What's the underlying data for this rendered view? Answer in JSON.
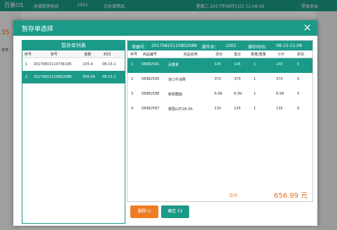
{
  "background": {
    "app_name": "百果OS",
    "system_label": "收银管理系统",
    "store_id": "1001",
    "store_name": "迈水果精品",
    "datetime": "星期二 2017年08月15日 11:08:06",
    "logout": "登录退出",
    "left_fragment_1": "35",
    "left_fragment_2": "单号："
  },
  "dialog": {
    "title": "暂存单选择",
    "close_glyph": "×"
  },
  "left_panel": {
    "title": "暂存单列表",
    "columns": [
      "序号",
      "单号",
      "金额",
      "时间"
    ],
    "rows": [
      {
        "no": "1",
        "order": "20170815110736195",
        "amount": "105.4",
        "time": "08-15-1"
      },
      {
        "no": "2",
        "order": "20170815110802088",
        "amount": "656.99",
        "time": "08-15-1"
      }
    ]
  },
  "right_panel": {
    "order_label": "单据号：",
    "order_no": "20170815110802088",
    "operator_label": "操作员：",
    "operator": "1001",
    "op_time_label": "操作时间：",
    "op_time": "08-15-11:08",
    "columns": [
      "序号",
      "商品编号",
      "商品名称",
      "原价",
      "售价",
      "数量/重量",
      "小计",
      "折扣"
    ],
    "rows": [
      {
        "no": "1",
        "code": "58982591",
        "name": "百香果",
        "orig": "145",
        "price": "145",
        "qty": "1",
        "subtotal": "145",
        "discount": "0"
      },
      {
        "no": "2",
        "code": "58982595",
        "name": "进口牛油果",
        "orig": "370",
        "price": "370",
        "qty": "1",
        "subtotal": "370",
        "discount": "0"
      },
      {
        "no": "3",
        "code": "58982588",
        "name": "新鲜菌菇",
        "orig": "6.99",
        "price": "6.99",
        "qty": "1",
        "subtotal": "6.99",
        "discount": "0"
      },
      {
        "no": "4",
        "code": "58982587",
        "name": "泰国山竹2A-3A",
        "orig": "135",
        "price": "135",
        "qty": "1",
        "subtotal": "135",
        "discount": "0"
      }
    ]
  },
  "footer": {
    "total_label": "合计",
    "total_value": "656.99",
    "currency": "元",
    "delete_button": "删除 U",
    "confirm_button": "确定 F2"
  },
  "colors": {
    "accent": "#1a9a87",
    "orange": "#f07c22"
  }
}
